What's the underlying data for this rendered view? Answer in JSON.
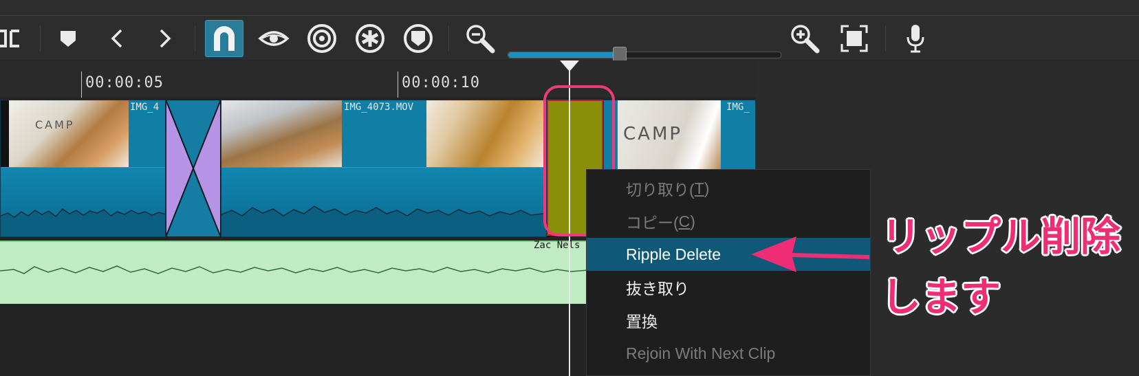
{
  "toolbar": {
    "tools": [
      {
        "name": "partial-tool-icon"
      },
      {
        "name": "marker-icon"
      },
      {
        "name": "previous-icon"
      },
      {
        "name": "next-icon"
      },
      {
        "name": "snap-magnet-icon",
        "active": true
      },
      {
        "name": "scrub-eye-icon"
      },
      {
        "name": "ripple-target-icon"
      },
      {
        "name": "ripple-all-tracks-icon"
      },
      {
        "name": "ripple-markers-icon"
      },
      {
        "name": "zoom-out-icon"
      },
      {
        "name": "zoom-in-icon"
      },
      {
        "name": "zoom-fit-icon"
      },
      {
        "name": "record-audio-icon"
      }
    ],
    "zoom_level": 0.41
  },
  "ruler": {
    "ticks": [
      "00:00:05",
      "00:00:10"
    ]
  },
  "clips": [
    {
      "label": "IMG_4"
    },
    {
      "label": "IMG_4073.MOV"
    },
    {
      "label": "IMG_"
    }
  ],
  "thumbnail_text": "CAMP",
  "audio": {
    "label": "Zac Nels"
  },
  "context_menu": {
    "items": [
      {
        "label_pre": "切り取り(",
        "mnemonic": "T",
        "label_post": ")",
        "state": "disabled"
      },
      {
        "label_pre": "コピー(",
        "mnemonic": "C",
        "label_post": ")",
        "state": "disabled"
      },
      {
        "label": "Ripple Delete",
        "state": "highlighted"
      },
      {
        "label": "抜き取り",
        "state": "enabled"
      },
      {
        "label": "置換",
        "state": "enabled"
      },
      {
        "label": "Rejoin With Next Clip",
        "state": "disabled"
      }
    ]
  },
  "annotation": {
    "line1": "リップル削除",
    "line2": "します",
    "color": "#ee2d74"
  },
  "colors": {
    "clip": "#117ea6",
    "transition": "#b793e6",
    "selected_clip": "#8a8f09",
    "audio": "#c1ebc2",
    "menu_highlight": "#0f5878"
  }
}
